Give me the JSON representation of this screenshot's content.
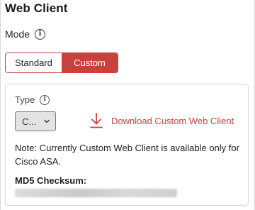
{
  "page": {
    "title": "Web Client"
  },
  "mode": {
    "label": "Mode",
    "info_icon": "info-circle-icon",
    "options": [
      "Standard",
      "Custom"
    ],
    "selected": "Custom"
  },
  "panel": {
    "type_label": "Type",
    "type_info_icon": "info-circle-icon",
    "type_value": "C...",
    "download_label": "Download Custom Web Client",
    "download_icon": "download-icon",
    "note": "Note: Currently Custom Web Client is available only for Cisco ASA.",
    "md5_label": "MD5 Checksum:",
    "md5_value": ""
  },
  "colors": {
    "accent": "#c8413d",
    "select_bg": "#e3e3e3",
    "border": "#d6d6d6"
  }
}
